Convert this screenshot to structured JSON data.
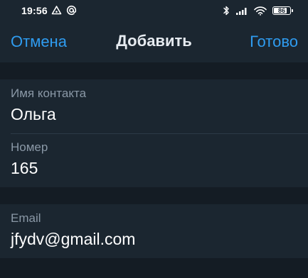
{
  "status_bar": {
    "time": "19:56",
    "left_icons": [
      "triangle-alert-icon",
      "at-sign-icon"
    ],
    "right_icons": [
      "bluetooth-icon",
      "signal-icon",
      "wifi-icon",
      "battery-icon"
    ],
    "battery_level": "86",
    "battery_fraction": 0.86
  },
  "toolbar": {
    "cancel_label": "Отмена",
    "title": "Добавить",
    "done_label": "Готово"
  },
  "fields": {
    "name": {
      "label": "Имя контакта",
      "value": "Ольга"
    },
    "number": {
      "label": "Номер",
      "value": "165"
    },
    "email": {
      "label": "Email",
      "value": "jfydv@gmail.com"
    }
  },
  "colors": {
    "background": "#141c24",
    "surface": "#1b2630",
    "accent": "#2f9cf0",
    "label": "#8a98a6",
    "text": "#ffffff"
  }
}
